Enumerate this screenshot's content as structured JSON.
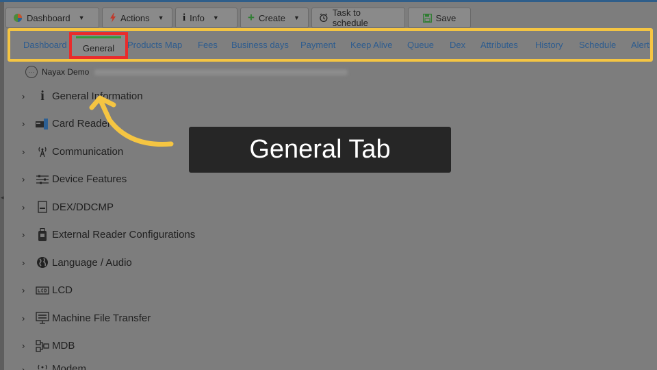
{
  "toolbar": {
    "dashboard_label": "Dashboard",
    "actions_label": "Actions",
    "info_label": "Info",
    "create_label": "Create",
    "task_label": "Task to schedule",
    "save_label": "Save"
  },
  "tabs": {
    "dashboard": "Dashboard",
    "general": "General",
    "products_map": "Products Map",
    "fees": "Fees",
    "business_days": "Business days",
    "payment": "Payment",
    "keep_alive": "Keep Alive",
    "queue": "Queue",
    "dex": "Dex",
    "attributes": "Attributes",
    "history": "History",
    "schedule": "Schedule",
    "alerts": "Alerts"
  },
  "machine": {
    "name": "Nayax Demo"
  },
  "tree": {
    "items": [
      {
        "label": "General Information",
        "icon": "info-icon"
      },
      {
        "label": "Card Reader",
        "icon": "card-reader-icon"
      },
      {
        "label": "Communication",
        "icon": "antenna-icon"
      },
      {
        "label": "Device Features",
        "icon": "features-icon"
      },
      {
        "label": "DEX/DDCMP",
        "icon": "dex-icon"
      },
      {
        "label": "External Reader Configurations",
        "icon": "external-reader-icon"
      },
      {
        "label": "Language / Audio",
        "icon": "globe-icon"
      },
      {
        "label": "LCD",
        "icon": "lcd-icon"
      },
      {
        "label": "Machine File Transfer",
        "icon": "file-transfer-icon"
      },
      {
        "label": "MDB",
        "icon": "mdb-icon"
      },
      {
        "label": "Modem",
        "icon": "modem-icon"
      }
    ]
  },
  "callout": {
    "text": "General Tab"
  },
  "colors": {
    "highlight_yellow": "#f5c542",
    "highlight_red": "#ea2b2b",
    "tab_link": "#2d5c8f",
    "active_tab_indicator": "#2f9e3a"
  }
}
